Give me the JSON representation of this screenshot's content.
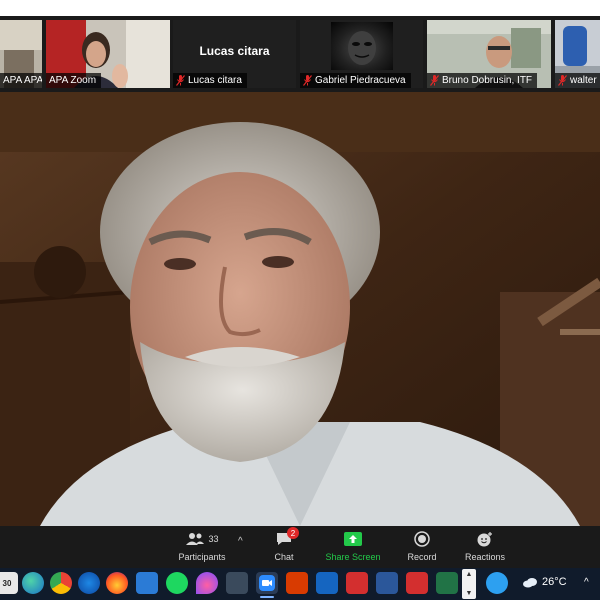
{
  "participants_strip": [
    {
      "name": "APA APA",
      "muted": false
    },
    {
      "name": "APA Zoom",
      "muted": false
    },
    {
      "name": "Lucas citara",
      "center_name": "Lucas citara",
      "muted": true
    },
    {
      "name": "Gabriel Piedracueva",
      "muted": true
    },
    {
      "name": "Bruno Dobrusin, ITF",
      "muted": true
    },
    {
      "name": "walter",
      "muted": true
    }
  ],
  "toolbar": {
    "participants_label": "Participants",
    "participants_count": "33",
    "chat_label": "Chat",
    "chat_badge": "2",
    "share_label": "Share Screen",
    "record_label": "Record",
    "reactions_label": "Reactions"
  },
  "taskbar": {
    "apps": [
      "calendar-icon",
      "edge-icon",
      "chrome-icon",
      "edge-dev-icon",
      "firefox-icon",
      "store-icon",
      "spotify-icon",
      "drop-icon",
      "calculator-icon",
      "zoom-icon",
      "office-icon",
      "dictionary-icon",
      "pdf-icon",
      "word-icon",
      "pdf-icon",
      "excel-icon"
    ],
    "calendar_day": "30",
    "weather_temp": "26°C"
  },
  "colors": {
    "share_green": "#23c94a",
    "mute_red": "#e02828",
    "toolbar_bg": "#1a1a1a",
    "taskbar_bg": "#101b2b"
  }
}
